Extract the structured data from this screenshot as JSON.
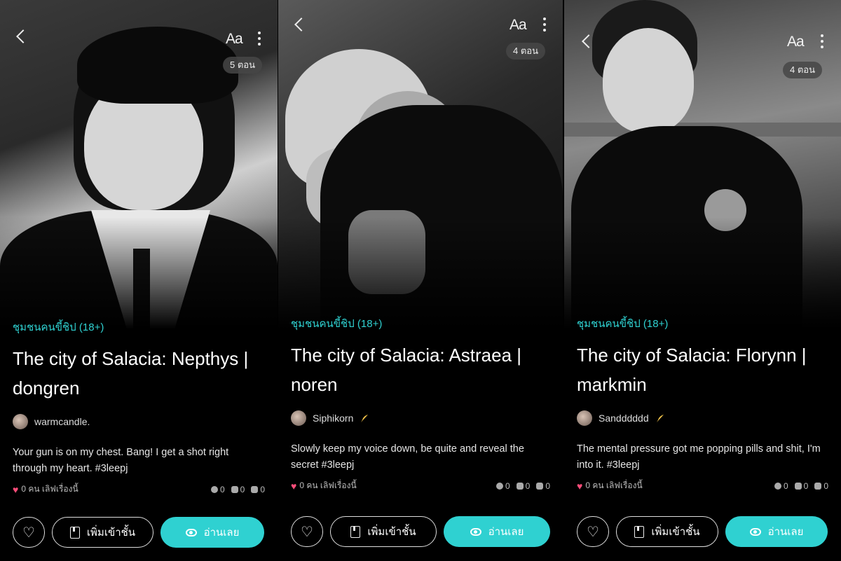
{
  "screens": [
    {
      "episodes": "5 ตอน",
      "category": "ชุมชนคนขี้ชิป (18+)",
      "title": "The city of Salacia: Nepthys | dongren",
      "author": "warmcandle.",
      "description": "Your gun is on my chest. Bang! I get a shot right through my heart. #3leepj",
      "likes_text": "0 คน เลิฟเรื่องนี้",
      "counts": {
        "comments_a": "0",
        "messages": "0",
        "bookmarks": "0"
      },
      "font_button": "Aa",
      "add_shelf_label": "เพิ่มเข้าชั้น",
      "read_label": "อ่านเลย"
    },
    {
      "episodes": "4 ตอน",
      "category": "ชุมชนคนขี้ชิป (18+)",
      "title": "The city of Salacia: Astraea | noren",
      "author": "Siphikorn",
      "description": "Slowly keep my voice down, be quite and reveal the secret #3leepj",
      "likes_text": "0 คน เลิฟเรื่องนี้",
      "counts": {
        "comments_a": "0",
        "messages": "0",
        "bookmarks": "0"
      },
      "font_button": "Aa",
      "add_shelf_label": "เพิ่มเข้าชั้น",
      "read_label": "อ่านเลย"
    },
    {
      "episodes": "4 ตอน",
      "category": "ชุมชนคนขี้ชิป (18+)",
      "title": "The city of Salacia: Florynn | markmin",
      "author": "Sandddddd",
      "description": "The mental pressure got me popping pills and shit, I'm into it. #3leepj",
      "likes_text": "0 คน เลิฟเรื่องนี้",
      "counts": {
        "comments_a": "0",
        "messages": "0",
        "bookmarks": "0"
      },
      "font_button": "Aa",
      "add_shelf_label": "เพิ่มเข้าชั้น",
      "read_label": "อ่านเลย"
    }
  ],
  "colors": {
    "accent": "#2fd1d1",
    "heart": "#ff4d7a",
    "background": "#000000"
  }
}
